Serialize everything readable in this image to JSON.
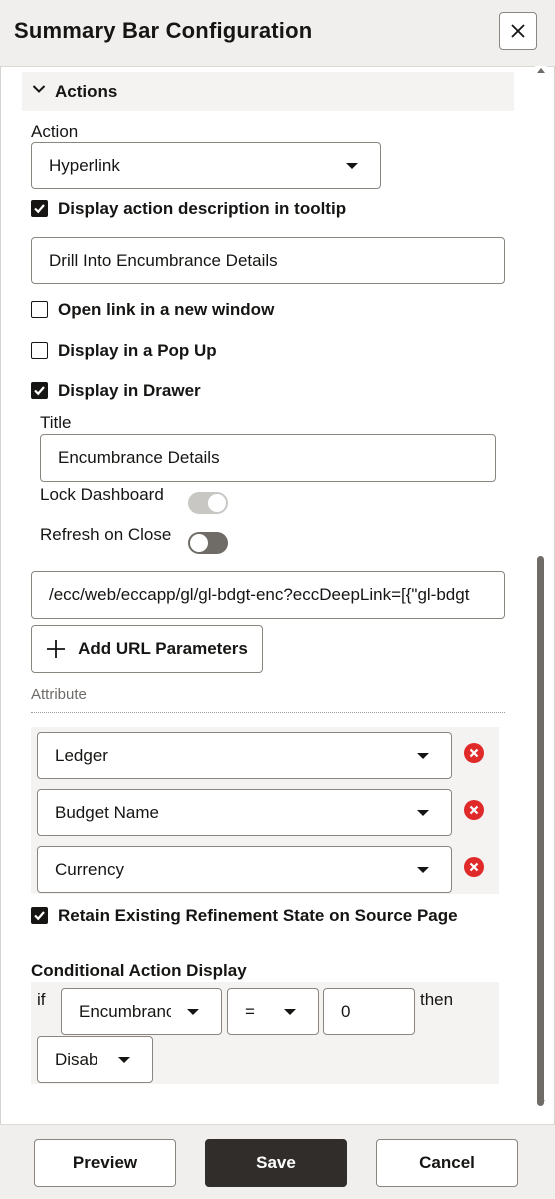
{
  "header": {
    "title": "Summary Bar Configuration"
  },
  "section": {
    "label": "Actions"
  },
  "action": {
    "label": "Action",
    "selected": "Hyperlink"
  },
  "tooltip": {
    "checkbox_label": "Display action description in tooltip",
    "checked": true,
    "description": "Drill Into Encumbrance Details"
  },
  "options": {
    "new_window": {
      "label": "Open link in a new window",
      "checked": false
    },
    "popup": {
      "label": "Display in a Pop Up",
      "checked": false
    },
    "drawer": {
      "label": "Display in Drawer",
      "checked": true
    }
  },
  "drawer": {
    "title_label": "Title",
    "title_value": "Encumbrance Details",
    "lock_label": "Lock Dashboard",
    "lock_on": false,
    "refresh_label": "Refresh on Close",
    "refresh_on": false
  },
  "url": {
    "value": "/ecc/web/eccapp/gl/gl-bdgt-enc?eccDeepLink=[{\"gl-bdgt"
  },
  "add_params": {
    "label": "Add URL Parameters"
  },
  "attributes": {
    "label": "Attribute",
    "items": [
      {
        "value": "Ledger"
      },
      {
        "value": "Budget Name"
      },
      {
        "value": "Currency"
      }
    ]
  },
  "retain": {
    "label": "Retain Existing Refinement State on Source Page",
    "checked": true
  },
  "conditional": {
    "label": "Conditional Action Display",
    "if_label": "if",
    "field_value": "Encumbrance",
    "operator_value": "=",
    "compare_value": "0",
    "then_label": "then",
    "result_value": "Disable"
  },
  "footer": {
    "preview": "Preview",
    "save": "Save",
    "cancel": "Cancel"
  },
  "colors": {
    "primary": "#312d2a",
    "remove": "#e02a2a",
    "toggle_off": "#6f6b67",
    "toggle_disabled": "#c9c7c4"
  }
}
